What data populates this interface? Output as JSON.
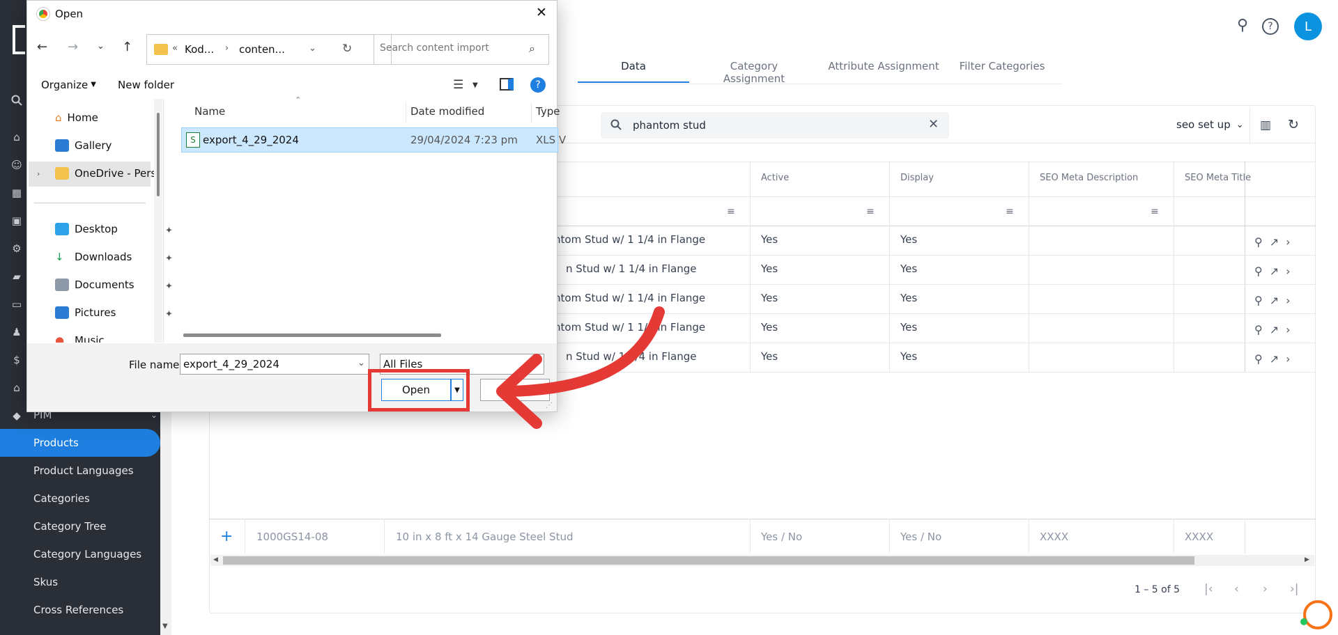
{
  "header": {
    "tabs": [
      {
        "label": "Data"
      },
      {
        "label": "Category Assignment"
      },
      {
        "label": "Attribute Assignment"
      },
      {
        "label": "Filter Categories"
      }
    ],
    "avatar_letter": "L"
  },
  "sidebar": {
    "section_label": "PIM",
    "items": [
      {
        "label": "Products"
      },
      {
        "label": "Product Languages"
      },
      {
        "label": "Categories"
      },
      {
        "label": "Category Tree"
      },
      {
        "label": "Category Languages"
      },
      {
        "label": "Skus"
      },
      {
        "label": "Cross References"
      }
    ]
  },
  "toolbar": {
    "search_value": "phantom stud",
    "view_select": "seo set up"
  },
  "table": {
    "headers": [
      "Active",
      "Display",
      "SEO Meta Description",
      "SEO Meta Title"
    ],
    "rows": [
      {
        "name": "ntom Stud w/ 1 1/4 in Flange",
        "active": "Yes",
        "display": "Yes"
      },
      {
        "name": "n Stud w/ 1 1/4 in Flange",
        "active": "Yes",
        "display": "Yes"
      },
      {
        "name": "ntom Stud w/ 1 1/4 in Flange",
        "active": "Yes",
        "display": "Yes"
      },
      {
        "name": "ntom Stud w/ 1 1/4 in Flange",
        "active": "Yes",
        "display": "Yes"
      },
      {
        "name": "n Stud w/ 1 1/4 in Flange",
        "active": "Yes",
        "display": "Yes"
      }
    ],
    "new_row": {
      "sku": "1000GS14-08",
      "name": "10 in x 8 ft x 14 Gauge Steel Stud",
      "active": "Yes / No",
      "display": "Yes / No",
      "seo_desc": "XXXX",
      "seo_title": "XXXX"
    },
    "pagination": "1 – 5 of 5"
  },
  "dialog": {
    "title": "Open",
    "breadcrumb": [
      "Kod...",
      "conten..."
    ],
    "search_placeholder": "Search content import",
    "organize_label": "Organize",
    "new_folder_label": "New folder",
    "nav": [
      {
        "label": "Home"
      },
      {
        "label": "Gallery"
      },
      {
        "label": "OneDrive - Perso"
      },
      {
        "label": "Desktop"
      },
      {
        "label": "Downloads"
      },
      {
        "label": "Documents"
      },
      {
        "label": "Pictures"
      },
      {
        "label": "Music"
      }
    ],
    "columns": [
      "Name",
      "Date modified",
      "Type"
    ],
    "files": [
      {
        "name": "export_4_29_2024",
        "date": "29/04/2024 7:23 pm",
        "type": "XLS V"
      }
    ],
    "file_name_label": "File name:",
    "file_name_value": "export_4_29_2024",
    "file_type": "All Files",
    "open_label": "Open",
    "cancel_label": "C"
  },
  "colors": {
    "accent": "#1f7fe0",
    "sidebar_bg": "#2a2e36",
    "annotation_red": "#e53935"
  }
}
